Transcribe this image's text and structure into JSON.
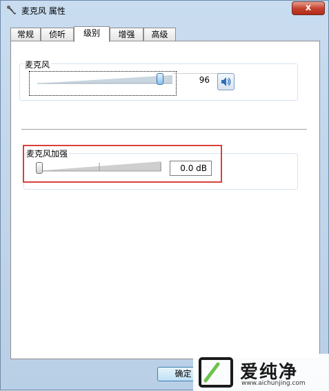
{
  "window": {
    "title": "麦克风 属性",
    "close_label": "x"
  },
  "tabs": [
    {
      "label": "常规",
      "active": false
    },
    {
      "label": "侦听",
      "active": false
    },
    {
      "label": "级别",
      "active": true
    },
    {
      "label": "增强",
      "active": false
    },
    {
      "label": "高级",
      "active": false
    }
  ],
  "microphone": {
    "label": "麦克风",
    "level": 96,
    "level_text": "96"
  },
  "boost": {
    "label": "麦克风加强",
    "value_text": "0.0 dB",
    "level_fraction": 0
  },
  "footer": {
    "ok_label": "确定"
  },
  "watermark": {
    "text": "爱纯净",
    "url": "www.aichunjing.com"
  },
  "colors": {
    "highlight": "#d9403a",
    "thumb": "#8cc2ef"
  },
  "icons": {
    "title": "microphone-icon",
    "speaker": "speaker-icon"
  }
}
